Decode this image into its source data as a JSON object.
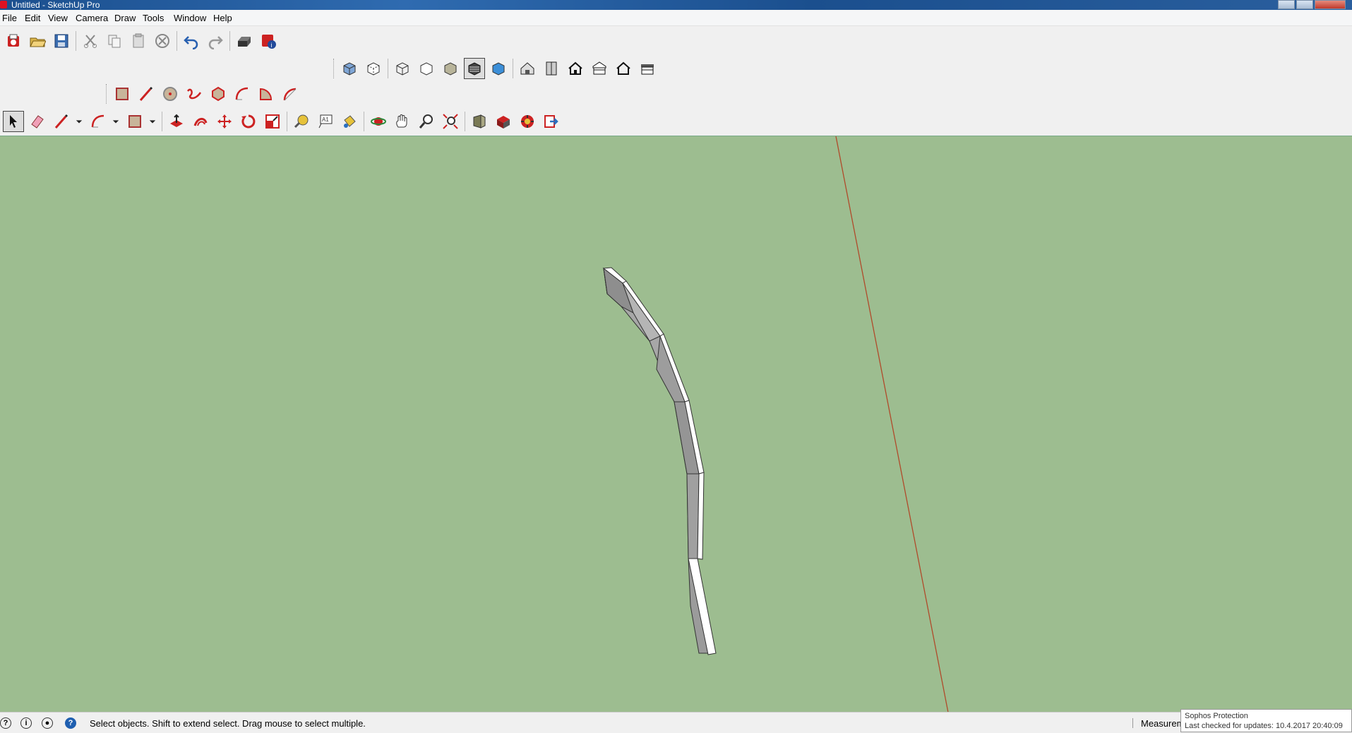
{
  "window": {
    "title": "Untitled - SketchUp Pro"
  },
  "menu": [
    "File",
    "Edit",
    "View",
    "Camera",
    "Draw",
    "Tools",
    "Window",
    "Help"
  ],
  "status": {
    "hint": "Select objects. Shift to extend select. Drag mouse to select multiple.",
    "measurements_label": "Measurem"
  },
  "notification": {
    "title": "Sophos Protection",
    "text": "Last checked for updates: 10.4.2017 20:40:09"
  },
  "colors": {
    "canvas": "#9dbd90",
    "red_axis": "#b04a2a",
    "model_face_light": "#ffffff",
    "model_face_dark": "#a8a8a8"
  },
  "toolbars": {
    "standard": [
      "new-icon",
      "open-icon",
      "save-icon",
      "cut-icon",
      "copy-icon",
      "paste-icon",
      "erase-icon",
      "undo-icon",
      "redo-icon",
      "print-icon",
      "model-info-icon"
    ],
    "styles": [
      "xray-icon",
      "back-edges-icon",
      "wireframe-icon",
      "hidden-line-icon",
      "shaded-icon",
      "shaded-textures-icon",
      "monochrome-icon"
    ],
    "views": [
      "iso-view-icon",
      "top-view-icon",
      "front-view-icon",
      "right-view-icon",
      "back-view-icon",
      "left-view-icon"
    ],
    "drawing": [
      "rectangle-icon",
      "line-icon",
      "circle-icon",
      "freehand-icon",
      "polygon-icon",
      "arc-icon",
      "pie-icon",
      "two-point-arc-icon"
    ],
    "main": [
      "select-icon",
      "eraser-icon",
      "pencil-icon",
      "arc-icon",
      "rectangle-icon",
      "push-pull-icon",
      "follow-me-icon",
      "move-icon",
      "rotate-icon",
      "scale-icon",
      "tape-measure-icon",
      "text-icon",
      "paint-bucket-icon",
      "orbit-icon",
      "pan-icon",
      "zoom-icon",
      "zoom-extents-icon",
      "warehouse-icon",
      "extension-warehouse-icon",
      "components-icon",
      "send-to-layout-icon"
    ]
  }
}
